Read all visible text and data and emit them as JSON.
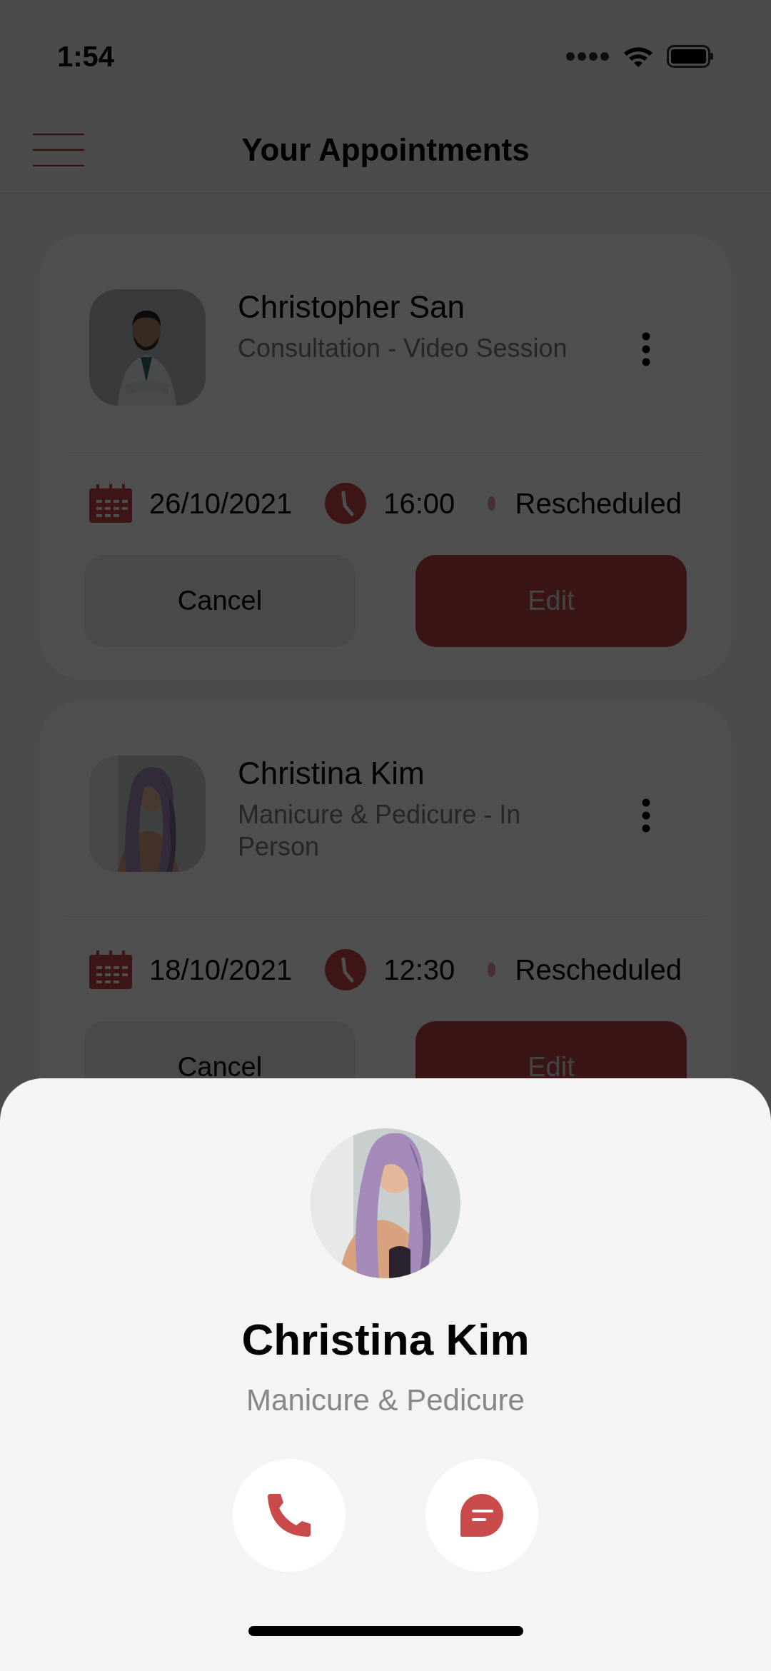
{
  "status_bar": {
    "time": "1:54"
  },
  "header": {
    "title": "Your Appointments"
  },
  "appointments": [
    {
      "name": "Christopher San",
      "service": "Consultation - Video Session",
      "date": "26/10/2021",
      "time": "16:00",
      "status": "Rescheduled",
      "cancel_label": "Cancel",
      "edit_label": "Edit"
    },
    {
      "name": "Christina Kim",
      "service": "Manicure & Pedicure - In Person",
      "date": "18/10/2021",
      "time": "12:30",
      "status": "Rescheduled",
      "cancel_label": "Cancel",
      "edit_label": "Edit"
    }
  ],
  "contact_sheet": {
    "name": "Christina Kim",
    "service": "Manicure & Pedicure"
  }
}
